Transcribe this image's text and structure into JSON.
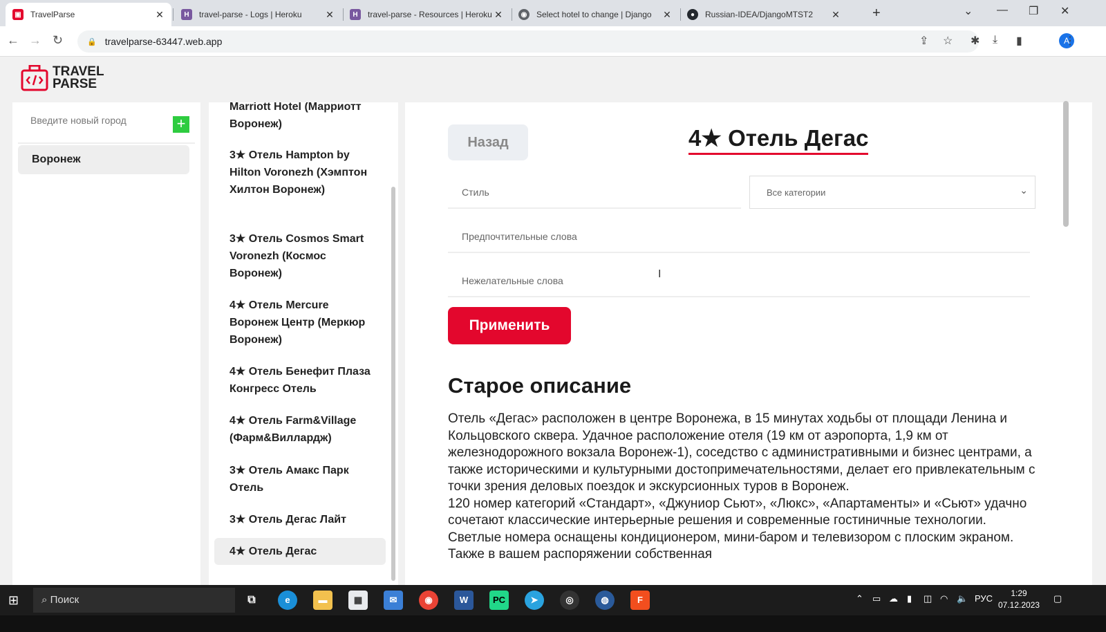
{
  "browser": {
    "tabs": [
      {
        "title": "TravelParse",
        "active": true,
        "icon": "travelparse-icon"
      },
      {
        "title": "travel-parse - Logs | Heroku",
        "icon": "heroku-icon"
      },
      {
        "title": "travel-parse - Resources | Heroku",
        "icon": "heroku-icon"
      },
      {
        "title": "Select hotel to change | Django",
        "icon": "globe-icon"
      },
      {
        "title": "Russian-IDEA/DjangoMTST2",
        "icon": "github-icon"
      }
    ],
    "url": "travelparse-63447.web.app",
    "avatar_letter": "A"
  },
  "app": {
    "logo_line1": "TRAVEL",
    "logo_line2": "PARSE",
    "brand_color": "#e3072d",
    "sidebar": {
      "new_city_placeholder": "Введите новый город",
      "add_symbol": "+",
      "cities": [
        "Воронеж"
      ]
    },
    "hotels": [
      "Marriott Hotel (Марриотт Воронеж)",
      "3★ Отель Hampton by Hilton Voronezh (Хэмптон Хилтон Воронеж)",
      "3★ Отель Cosmos Smart Voronezh (Космос Воронеж)",
      "4★ Отель Mercure Воронеж Центр (Меркюр Воронеж)",
      "4★ Отель Бенефит Плаза Конгресс Отель",
      "4★ Отель Farm&Village (Фарм&Виллардж)",
      "3★ Отель Амакс Парк Отель",
      "3★ Отель Дегас Лайт",
      "4★ Отель Дегас"
    ],
    "selected_hotel": "4★ Отель Дегас",
    "main": {
      "back_label": "Назад",
      "title": "4★ Отель Дегас",
      "style_placeholder": "Стиль",
      "category_value": "Все категории",
      "preferred_placeholder": "Предпочтительные слова",
      "unwanted_placeholder": "Нежелательные слова",
      "apply_label": "Применить",
      "old_description_heading": "Старое описание",
      "old_description_p1": "Отель «Дегас» расположен в центре Воронежа, в 15 минутах ходьбы от площади Ленина и Кольцовского сквера. Удачное расположение отеля (19 км от аэропорта, 1,9 км от железнодорожного вокзала Воронеж-1), соседство с административными и бизнес центрами, а также историческими и культурными достопримечательностями, делает его привлекательным с точки зрения деловых поездок и экскурсионных туров в Воронеж.",
      "old_description_p2": "120 номер категорий «Стандарт», «Джуниор Сьют», «Люкс», «Апартаменты» и «Сьют» удачно сочетают классические интерьерные решения и современные гостиничные технологии. Светлые номера оснащены кондиционером, мини-баром и телевизором с плоским экраном. Также в вашем распоряжении собственная"
    }
  },
  "taskbar": {
    "search_label": "Поиск",
    "language": "РУС",
    "time": "1:29",
    "date": "07.12.2023"
  }
}
